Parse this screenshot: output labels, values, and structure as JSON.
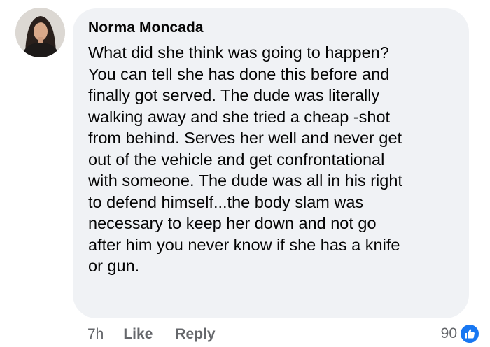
{
  "comment": {
    "author": "Norma Moncada",
    "lines": [
      "What did she think was going to happen?",
      "You can tell she has done this before and",
      "finally got served. The dude was literally",
      "walking away and she tried a cheap -shot",
      "from behind. Serves her well and never get",
      "out of the vehicle and get confrontational",
      "with someone. The dude was all in his right",
      "to defend himself...the body slam was",
      "necessary to keep her down and not go",
      "after him you never know if she has a knife",
      "or gun."
    ]
  },
  "actions": {
    "time": "7h",
    "like_label": "Like",
    "reply_label": "Reply"
  },
  "reactions": {
    "count": "90",
    "icon": "thumbs-up-icon",
    "badge_color": "#1877f2"
  },
  "colors": {
    "bubble_bg": "#f0f2f5",
    "meta_text": "#65676b"
  }
}
